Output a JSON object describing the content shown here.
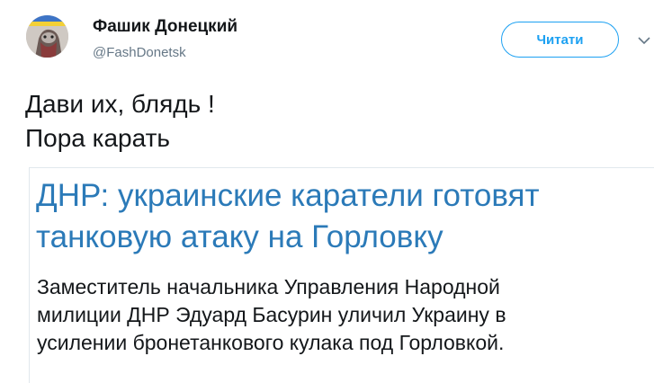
{
  "author": {
    "display_name": "Фашик Донецкий",
    "handle": "@FashDonetsk"
  },
  "follow_button": {
    "label": "Читати"
  },
  "icons": {
    "more": "chevron-down-icon",
    "avatar": "avatar-image"
  },
  "tweet": {
    "lines": [
      "Дави их, блядь !",
      "Пора карать"
    ]
  },
  "card": {
    "title_lines": [
      "ДНР: украинские каратели готовят",
      "танковую атаку на Горловку"
    ],
    "description_lines": [
      "Заместитель начальника Управления Народной",
      "милиции ДНР Эдуард Басурин уличил Украину в",
      "усилении бронетанкового кулака под Горловкой."
    ]
  },
  "colors": {
    "accent": "#1da1f2",
    "card_title": "#2b7ab8",
    "text": "#14171a",
    "muted": "#657786",
    "border": "#e1e8ed"
  }
}
